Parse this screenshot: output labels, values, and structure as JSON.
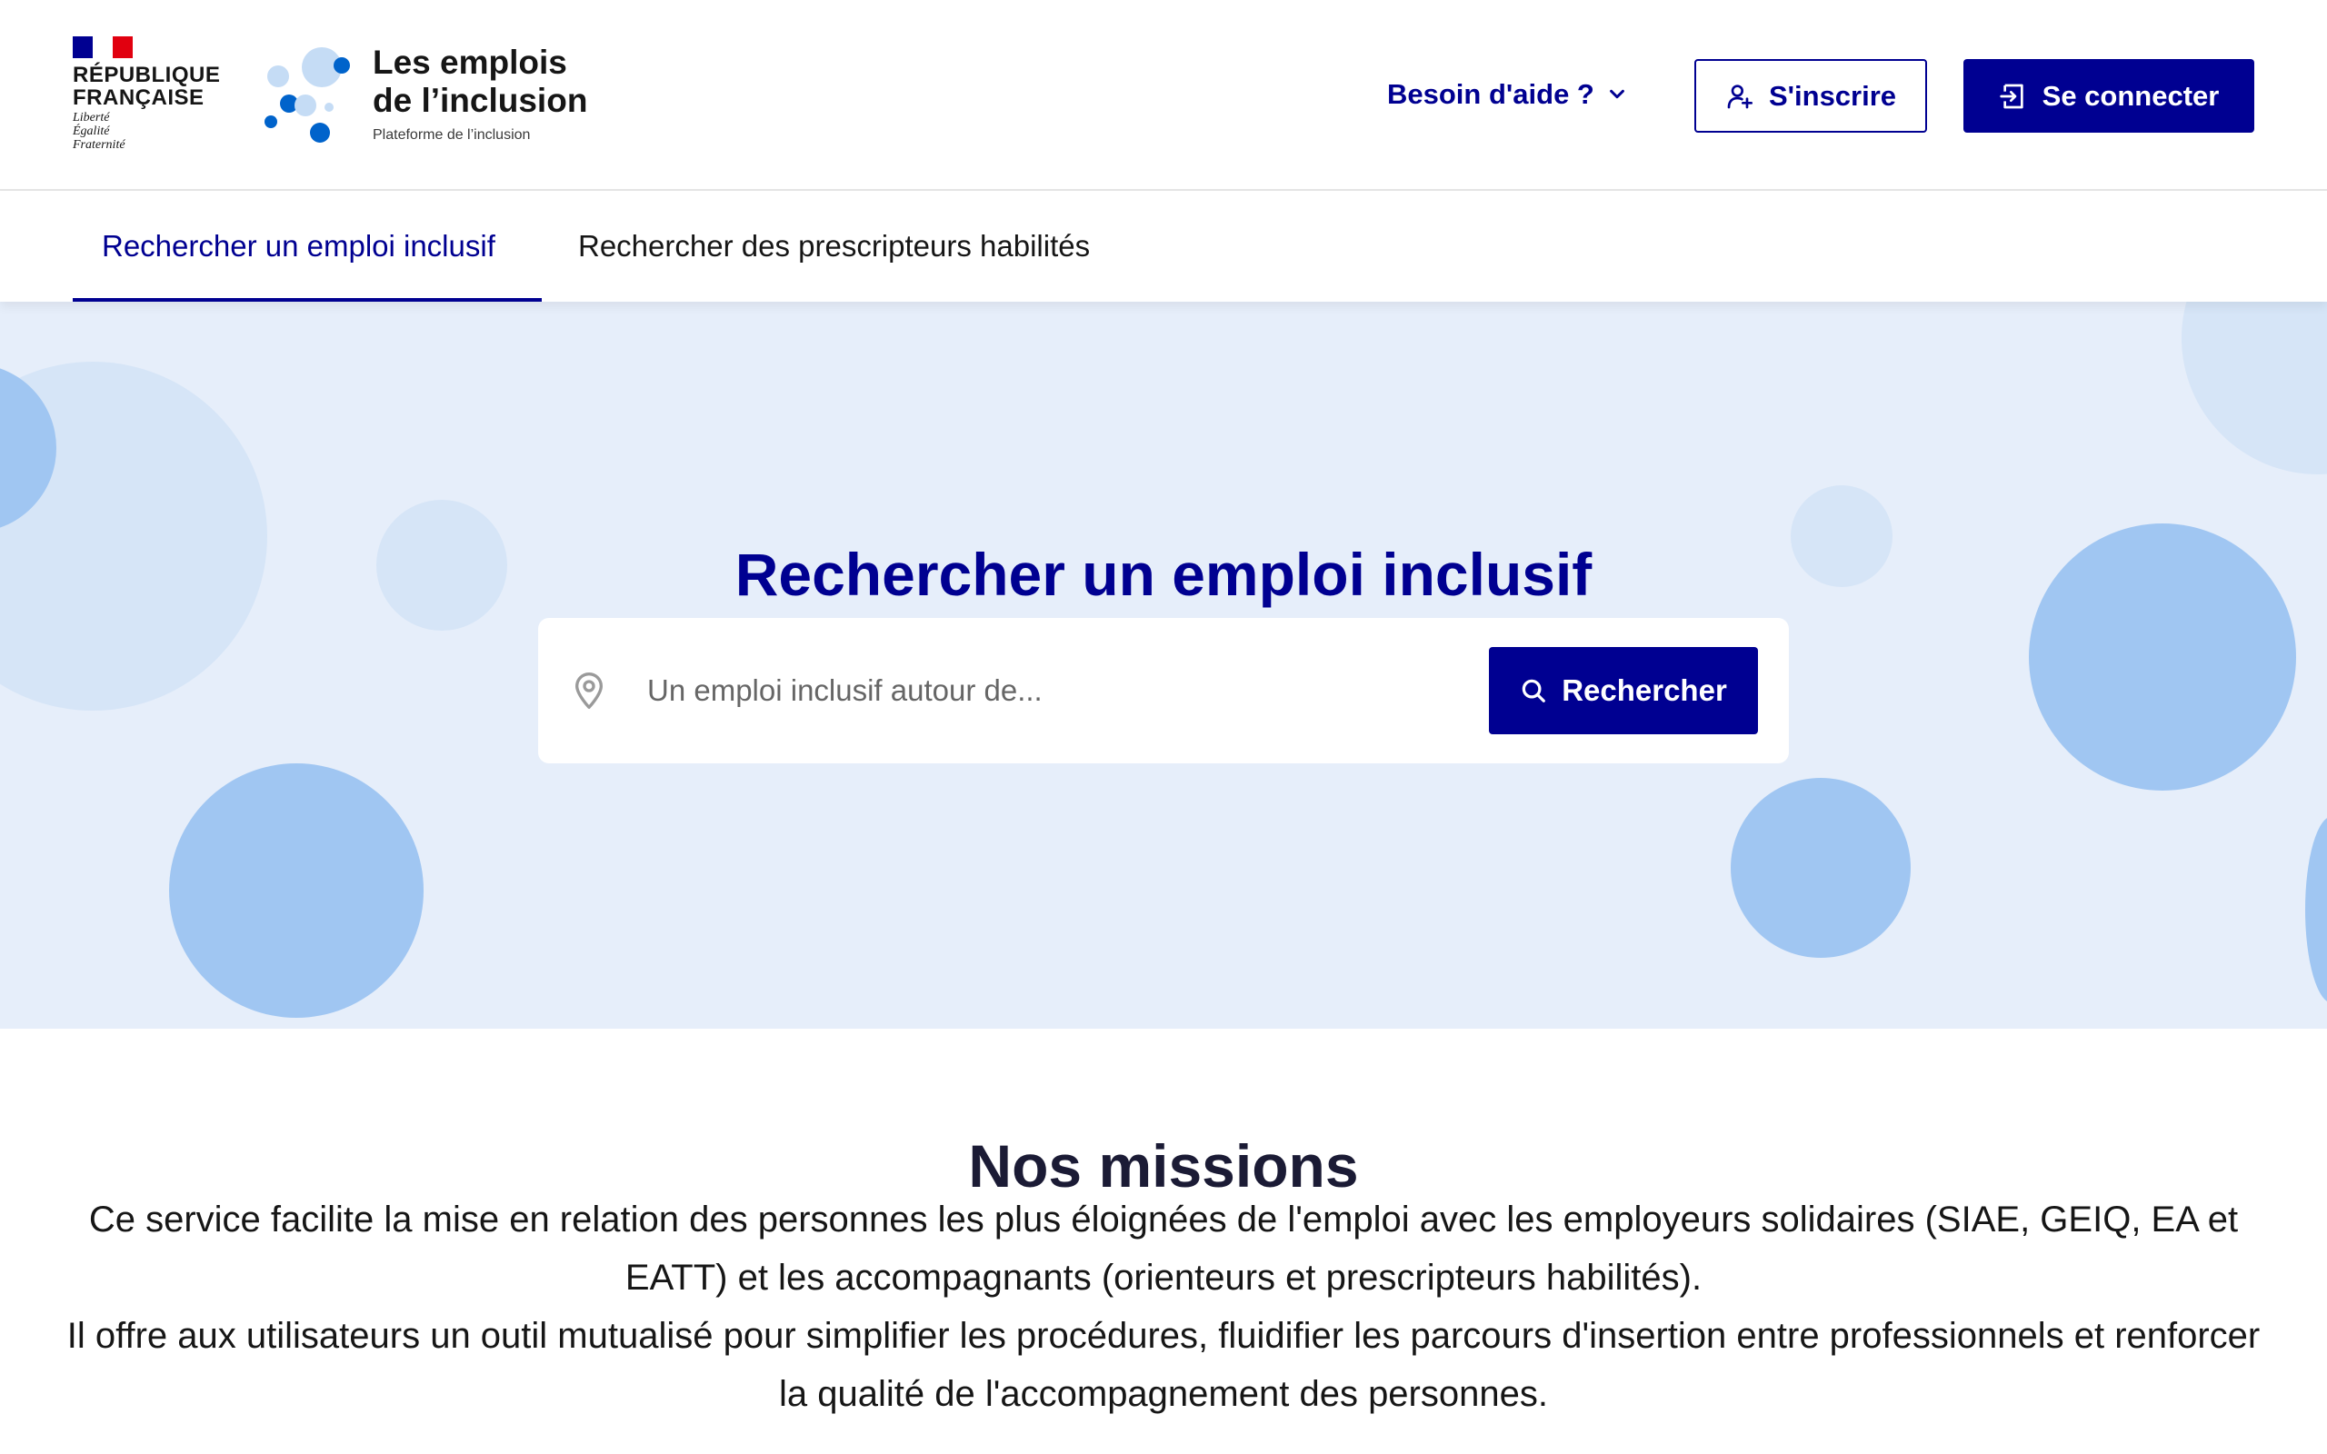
{
  "header": {
    "gov_logo": {
      "name": "RÉPUBLIQUE\nFRANÇAISE",
      "motto": "Liberté\nÉgalité\nFraternité"
    },
    "brand": {
      "title": "Les emplois de l’inclusion",
      "subtitle": "Plateforme de l’inclusion"
    },
    "help_label": "Besoin d'aide ?",
    "signup_label": "S'inscrire",
    "login_label": "Se connecter"
  },
  "tabs": [
    {
      "label": "Rechercher un emploi inclusif",
      "active": true
    },
    {
      "label": "Rechercher des prescripteurs habilités",
      "active": false
    }
  ],
  "hero": {
    "title": "Rechercher un emploi inclusif",
    "search": {
      "placeholder": "Un emploi inclusif autour de...",
      "value": "",
      "button_label": "Rechercher"
    }
  },
  "missions": {
    "title": "Nos missions",
    "paragraph1": "Ce service facilite la mise en relation des personnes les plus éloignées de l'emploi avec les employeurs solidaires (SIAE, GEIQ, EA et EATT) et les accompagnants (orienteurs et prescripteurs habilités).",
    "paragraph2": "Il offre aux utilisateurs un outil mutualisé pour simplifier les procédures, fluidifier les parcours d'insertion entre professionnels et renforcer la qualité de l'accompagnement des personnes."
  },
  "colors": {
    "primary": "#000091",
    "hero_background": "#e6eefa",
    "bubble_dark": "#a0c6f2",
    "bubble_light": "#d6e5f7",
    "flag_red": "#e1000f"
  },
  "icons": {
    "help": "chevron-down-icon",
    "signup": "user-add-icon",
    "login": "login-icon",
    "search_field": "map-pin-icon",
    "search_button": "search-icon"
  }
}
